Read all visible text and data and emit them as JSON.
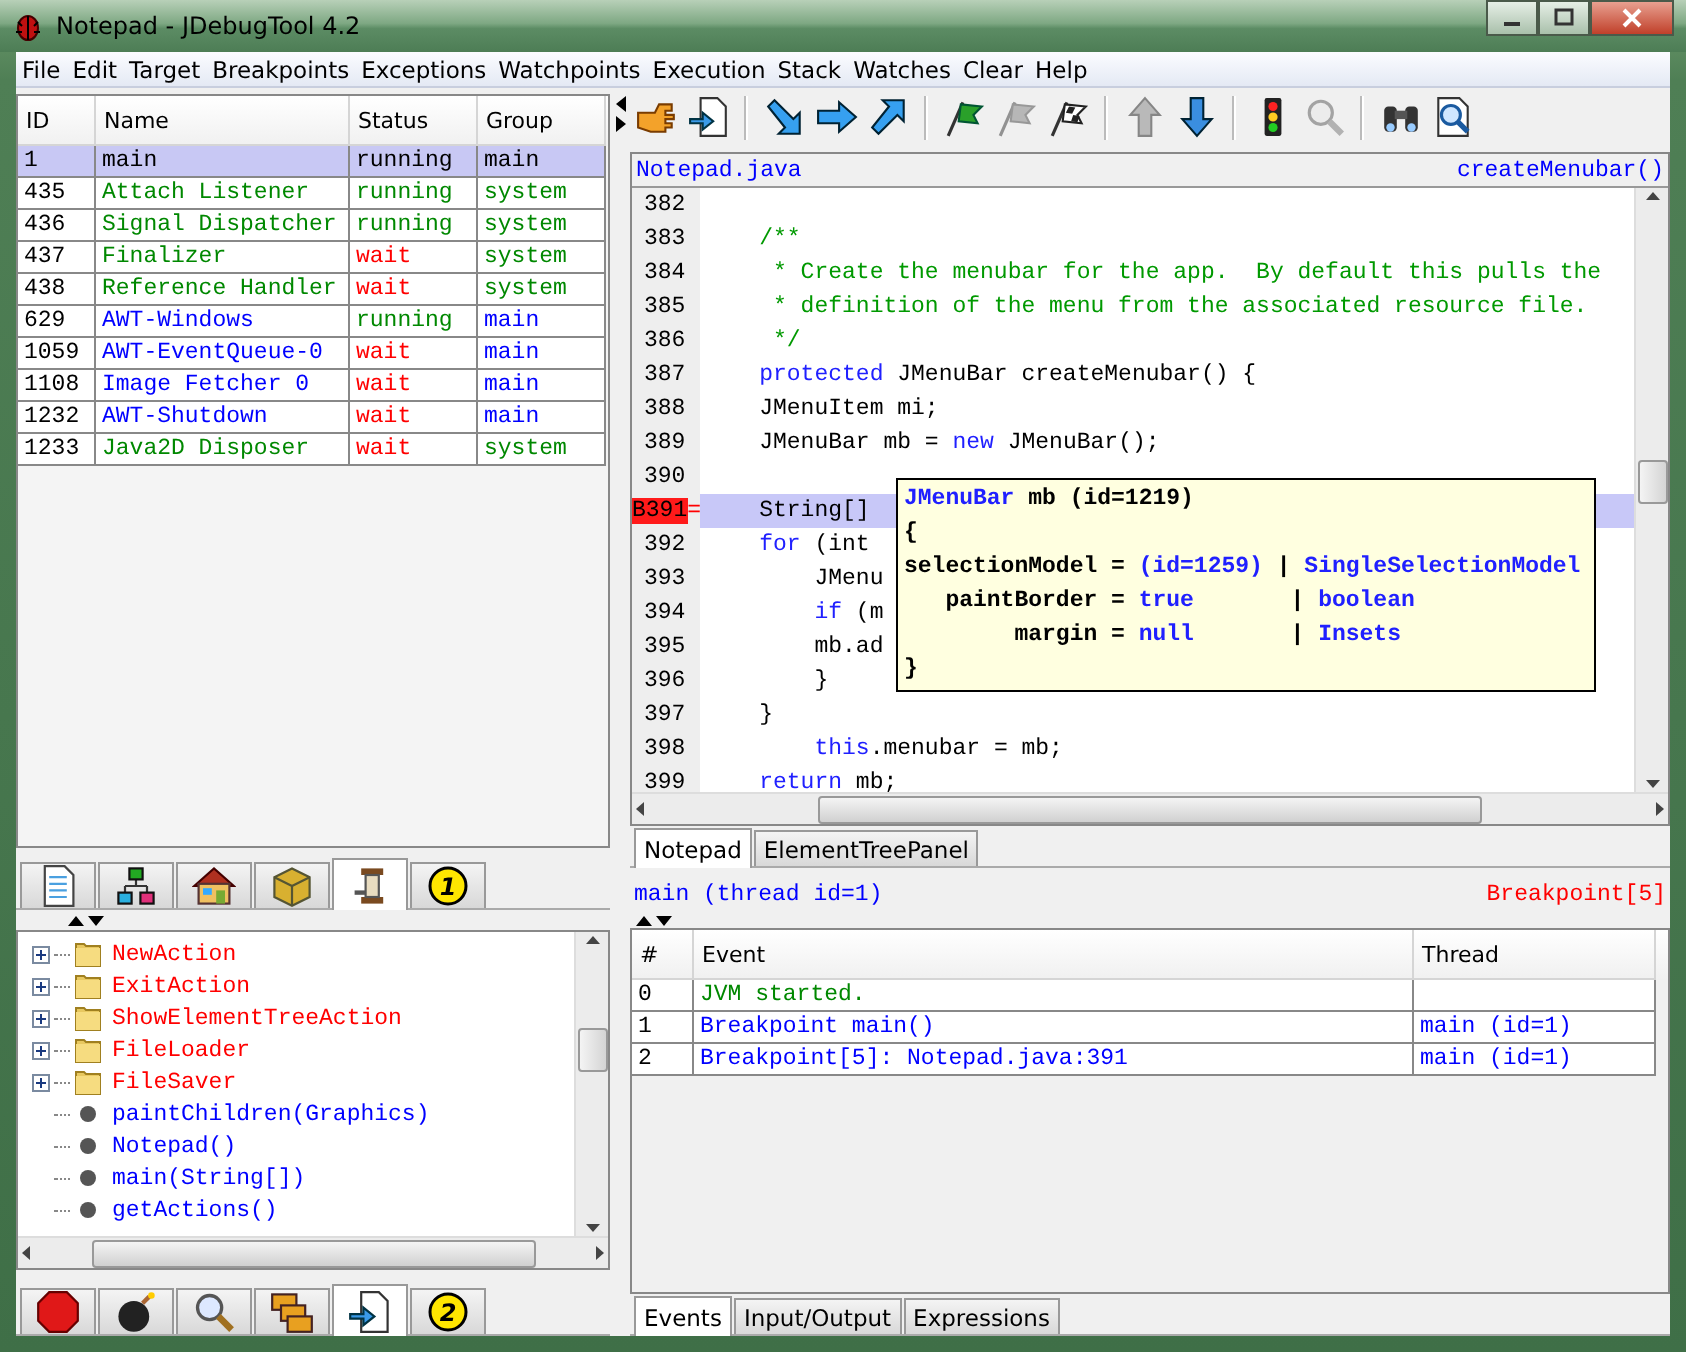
{
  "window": {
    "title": "Notepad - JDebugTool 4.2"
  },
  "menu": [
    "File",
    "Edit",
    "Target",
    "Breakpoints",
    "Exceptions",
    "Watchpoints",
    "Execution",
    "Stack",
    "Watches",
    "Clear",
    "Help"
  ],
  "threads": {
    "columns": [
      "ID",
      "Name",
      "Status",
      "Group"
    ],
    "rows": [
      {
        "selected": true,
        "cells": [
          {
            "text": "1",
            "color": "#000000"
          },
          {
            "text": "main",
            "color": "#000000"
          },
          {
            "text": "running",
            "color": "#000000"
          },
          {
            "text": "main",
            "color": "#000000"
          }
        ]
      },
      {
        "selected": false,
        "cells": [
          {
            "text": "435",
            "color": "#000000"
          },
          {
            "text": "Attach Listener",
            "color": "#008800"
          },
          {
            "text": "running",
            "color": "#008800"
          },
          {
            "text": "system",
            "color": "#008800"
          }
        ]
      },
      {
        "selected": false,
        "cells": [
          {
            "text": "436",
            "color": "#000000"
          },
          {
            "text": "Signal Dispatcher",
            "color": "#008800"
          },
          {
            "text": "running",
            "color": "#008800"
          },
          {
            "text": "system",
            "color": "#008800"
          }
        ]
      },
      {
        "selected": false,
        "cells": [
          {
            "text": "437",
            "color": "#000000"
          },
          {
            "text": "Finalizer",
            "color": "#008800"
          },
          {
            "text": "wait",
            "color": "#ff0000"
          },
          {
            "text": "system",
            "color": "#008800"
          }
        ]
      },
      {
        "selected": false,
        "cells": [
          {
            "text": "438",
            "color": "#000000"
          },
          {
            "text": "Reference Handler",
            "color": "#008800"
          },
          {
            "text": "wait",
            "color": "#ff0000"
          },
          {
            "text": "system",
            "color": "#008800"
          }
        ]
      },
      {
        "selected": false,
        "cells": [
          {
            "text": "629",
            "color": "#000000"
          },
          {
            "text": "AWT-Windows",
            "color": "#0000ff"
          },
          {
            "text": "running",
            "color": "#008800"
          },
          {
            "text": "main",
            "color": "#0000ff"
          }
        ]
      },
      {
        "selected": false,
        "cells": [
          {
            "text": "1059",
            "color": "#000000"
          },
          {
            "text": "AWT-EventQueue-0",
            "color": "#0000ff"
          },
          {
            "text": "wait",
            "color": "#ff0000"
          },
          {
            "text": "main",
            "color": "#0000ff"
          }
        ]
      },
      {
        "selected": false,
        "cells": [
          {
            "text": "1108",
            "color": "#000000"
          },
          {
            "text": "Image Fetcher 0",
            "color": "#0000ff"
          },
          {
            "text": "wait",
            "color": "#ff0000"
          },
          {
            "text": "main",
            "color": "#0000ff"
          }
        ]
      },
      {
        "selected": false,
        "cells": [
          {
            "text": "1232",
            "color": "#000000"
          },
          {
            "text": "AWT-Shutdown",
            "color": "#0000ff"
          },
          {
            "text": "wait",
            "color": "#ff0000"
          },
          {
            "text": "main",
            "color": "#0000ff"
          }
        ]
      },
      {
        "selected": false,
        "cells": [
          {
            "text": "1233",
            "color": "#000000"
          },
          {
            "text": "Java2D Disposer",
            "color": "#008800"
          },
          {
            "text": "wait",
            "color": "#ff0000"
          },
          {
            "text": "system",
            "color": "#008800"
          }
        ]
      }
    ]
  },
  "left_tabs_top": [
    {
      "kind": "document",
      "selected": false
    },
    {
      "kind": "tree",
      "selected": false
    },
    {
      "kind": "house",
      "selected": false
    },
    {
      "kind": "box",
      "selected": false
    },
    {
      "kind": "spool",
      "selected": true
    },
    {
      "kind": "badge",
      "label": "1",
      "selected": false
    }
  ],
  "class_tree": [
    {
      "kind": "class",
      "label": "NewAction",
      "expanded": false
    },
    {
      "kind": "class",
      "label": "ExitAction",
      "expanded": false
    },
    {
      "kind": "class",
      "label": "ShowElementTreeAction",
      "expanded": false
    },
    {
      "kind": "class",
      "label": "FileLoader",
      "expanded": false
    },
    {
      "kind": "class",
      "label": "FileSaver",
      "expanded": false
    },
    {
      "kind": "method",
      "label": "paintChildren(Graphics)"
    },
    {
      "kind": "method",
      "label": "Notepad()"
    },
    {
      "kind": "method",
      "label": "main(String[])"
    },
    {
      "kind": "method",
      "label": "getActions()"
    }
  ],
  "left_tabs_bottom": [
    {
      "kind": "stop",
      "selected": false
    },
    {
      "kind": "bomb",
      "selected": false
    },
    {
      "kind": "magnifier",
      "selected": false
    },
    {
      "kind": "windows",
      "selected": false
    },
    {
      "kind": "doc-arrow",
      "selected": true
    },
    {
      "kind": "badge",
      "label": "2",
      "selected": false
    }
  ],
  "toolbar": [
    {
      "kind": "hand",
      "disabled": false
    },
    {
      "kind": "doc-arrow",
      "disabled": false
    },
    {
      "kind": "separator"
    },
    {
      "kind": "step-into",
      "disabled": false
    },
    {
      "kind": "step-over",
      "disabled": false
    },
    {
      "kind": "step-out",
      "disabled": false
    },
    {
      "kind": "separator"
    },
    {
      "kind": "flag",
      "disabled": false
    },
    {
      "kind": "flag",
      "disabled": true
    },
    {
      "kind": "checkered-flag",
      "disabled": false
    },
    {
      "kind": "separator"
    },
    {
      "kind": "arrow-up",
      "disabled": true
    },
    {
      "kind": "arrow-down",
      "disabled": false
    },
    {
      "kind": "separator"
    },
    {
      "kind": "traffic-light",
      "disabled": false
    },
    {
      "kind": "magnifier",
      "disabled": true
    },
    {
      "kind": "separator"
    },
    {
      "kind": "binoculars",
      "disabled": false
    },
    {
      "kind": "find-doc",
      "disabled": false
    }
  ],
  "source": {
    "file": "Notepad.java",
    "method": "createMenubar()",
    "lines": [
      {
        "number": "382",
        "breakpoint": false,
        "current": false
      },
      {
        "number": "383",
        "breakpoint": false,
        "current": false,
        "segments": [
          {
            "text": "    /**",
            "kind": "comment"
          }
        ]
      },
      {
        "number": "384",
        "breakpoint": false,
        "current": false,
        "segments": [
          {
            "text": "     * Create the menubar for the app.  By default this pulls the",
            "kind": "comment"
          }
        ]
      },
      {
        "number": "385",
        "breakpoint": false,
        "current": false,
        "segments": [
          {
            "text": "     * definition of the menu from the associated resource file.",
            "kind": "comment"
          }
        ]
      },
      {
        "number": "386",
        "breakpoint": false,
        "current": false,
        "segments": [
          {
            "text": "     */",
            "kind": "comment"
          }
        ]
      },
      {
        "number": "387",
        "breakpoint": false,
        "current": false,
        "segments": [
          {
            "text": "    protected",
            "kind": "keyword"
          },
          {
            "text": " JMenuBar createMenubar() {",
            "kind": "plain"
          }
        ]
      },
      {
        "number": "388",
        "breakpoint": false,
        "current": false,
        "segments": [
          {
            "text": "    JMenuItem mi;",
            "kind": "plain"
          }
        ]
      },
      {
        "number": "389",
        "breakpoint": false,
        "current": false,
        "segments": [
          {
            "text": "    JMenuBar mb = ",
            "kind": "plain"
          },
          {
            "text": "new",
            "kind": "keyword"
          },
          {
            "text": " JMenuBar();",
            "kind": "plain"
          }
        ]
      },
      {
        "number": "390",
        "breakpoint": false,
        "current": false
      },
      {
        "number": "B391",
        "marker": "=",
        "breakpoint": true,
        "current": true,
        "segments": [
          {
            "text": "    String[] ",
            "kind": "plain"
          }
        ]
      },
      {
        "number": "392",
        "breakpoint": false,
        "current": false,
        "segments": [
          {
            "text": "    for",
            "kind": "keyword"
          },
          {
            "text": " (int ",
            "kind": "plain"
          }
        ]
      },
      {
        "number": "393",
        "breakpoint": false,
        "current": false,
        "segments": [
          {
            "text": "        JMenu",
            "kind": "plain"
          }
        ]
      },
      {
        "number": "394",
        "breakpoint": false,
        "current": false,
        "segments": [
          {
            "text": "        if",
            "kind": "keyword"
          },
          {
            "text": " (m",
            "kind": "plain"
          }
        ]
      },
      {
        "number": "395",
        "breakpoint": false,
        "current": false,
        "segments": [
          {
            "text": "        mb.ad",
            "kind": "plain"
          }
        ]
      },
      {
        "number": "396",
        "breakpoint": false,
        "current": false,
        "segments": [
          {
            "text": "        }",
            "kind": "plain"
          }
        ]
      },
      {
        "number": "397",
        "breakpoint": false,
        "current": false,
        "segments": [
          {
            "text": "    }",
            "kind": "plain"
          }
        ]
      },
      {
        "number": "398",
        "breakpoint": false,
        "current": false,
        "segments": [
          {
            "text": "        this",
            "kind": "keyword"
          },
          {
            "text": ".menubar = mb;",
            "kind": "plain"
          }
        ]
      },
      {
        "number": "399",
        "breakpoint": false,
        "current": false,
        "segments": [
          {
            "text": "    return",
            "kind": "keyword"
          },
          {
            "text": " mb;",
            "kind": "plain"
          }
        ]
      }
    ],
    "tooltip": {
      "lines": [
        [
          {
            "text": "JMenuBar",
            "kind": "keyword"
          },
          {
            "text": " mb (id=1219)",
            "kind": "plain"
          }
        ],
        [
          {
            "text": "{",
            "kind": "plain"
          }
        ],
        [
          {
            "text": "selectionModel = ",
            "kind": "plain"
          },
          {
            "text": "(id=1259)",
            "kind": "keyword"
          },
          {
            "text": " | ",
            "kind": "plain"
          },
          {
            "text": "SingleSelectionModel",
            "kind": "keyword"
          }
        ],
        [
          {
            "text": "   paintBorder = ",
            "kind": "plain"
          },
          {
            "text": "true",
            "kind": "keyword"
          },
          {
            "text": "       | ",
            "kind": "plain"
          },
          {
            "text": "boolean",
            "kind": "keyword"
          }
        ],
        [
          {
            "text": "        margin = ",
            "kind": "plain"
          },
          {
            "text": "null",
            "kind": "keyword"
          },
          {
            "text": "       | ",
            "kind": "plain"
          },
          {
            "text": "Insets",
            "kind": "keyword"
          }
        ],
        [
          {
            "text": "}",
            "kind": "plain"
          }
        ]
      ]
    }
  },
  "source_tabs": [
    {
      "label": "Notepad",
      "selected": true
    },
    {
      "label": "ElementTreePanel",
      "selected": false
    }
  ],
  "status": {
    "thread": "main (thread id=1)",
    "event": "Breakpoint[5]"
  },
  "events": {
    "columns": [
      "#",
      "Event",
      "Thread"
    ],
    "rows": [
      {
        "cells": [
          {
            "text": "0",
            "color": "#000000"
          },
          {
            "text": "JVM started.",
            "color": "#008800"
          }
        ]
      },
      {
        "cells": [
          {
            "text": "1",
            "color": "#000000"
          },
          {
            "text": "Breakpoint main()",
            "color": "#0000ff"
          },
          {
            "text": "main (id=1)",
            "color": "#0000ff"
          }
        ]
      },
      {
        "cells": [
          {
            "text": "2",
            "color": "#000000"
          },
          {
            "text": "Breakpoint[5]: Notepad.java:391",
            "color": "#0000ff"
          },
          {
            "text": "main (id=1)",
            "color": "#0000ff"
          }
        ]
      }
    ]
  },
  "bottom_tabs": [
    {
      "label": "Events",
      "selected": true
    },
    {
      "label": "Input/Output",
      "selected": false
    },
    {
      "label": "Expressions",
      "selected": false
    }
  ]
}
